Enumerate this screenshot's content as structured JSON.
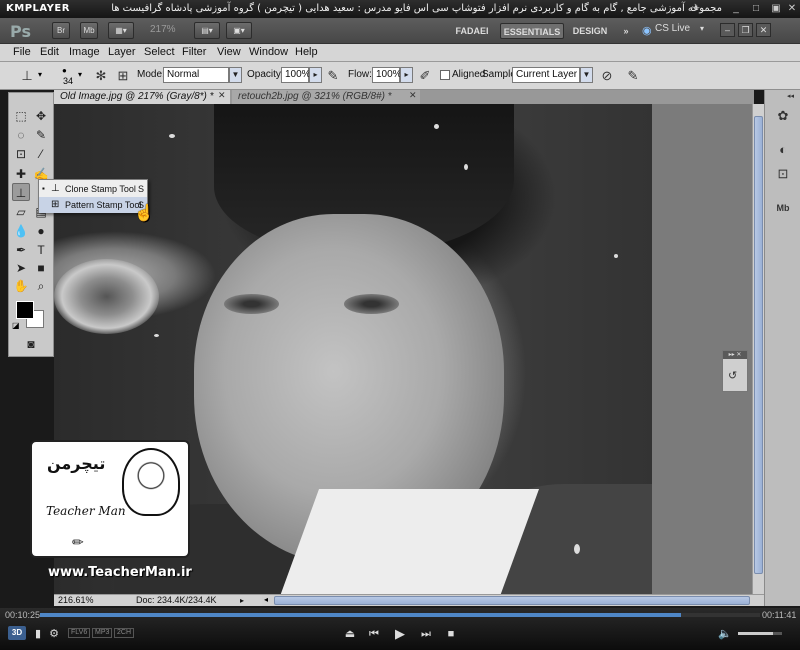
{
  "player": {
    "logo": "KMPLAYER",
    "caption": "مجموعه آموزشی جامع , گام به گام و کاربردی نرم افزار فتوشاپ سی اس فایو مدرس : سعید هدایی ( تیچرمن ) گروه آموزشی پادشاه گرافیست ها",
    "time_elapsed": "00:10:25",
    "time_total": "00:11:41",
    "progress": 0.89,
    "volume": 0.8,
    "codecs": [
      "FLV6",
      "MP3",
      "2CH"
    ],
    "badge_3d": "3D"
  },
  "appbar": {
    "logo": "Ps",
    "buttons": [
      "Br",
      "Mb"
    ],
    "zoom": "217%",
    "workspaces": [
      "FADAEI",
      "ESSENTIALS",
      "DESIGN"
    ],
    "more": "»",
    "cs_live": "CS Live"
  },
  "menu": [
    "File",
    "Edit",
    "Image",
    "Layer",
    "Select",
    "Filter",
    "View",
    "Window",
    "Help"
  ],
  "options": {
    "brush_size": "34",
    "mode_label": "Mode:",
    "mode_value": "Normal",
    "opacity_label": "Opacity:",
    "opacity_value": "100%",
    "flow_label": "Flow:",
    "flow_value": "100%",
    "aligned_label": "Aligned",
    "sample_label": "Sample:",
    "sample_value": "Current Layer"
  },
  "tabs": [
    {
      "label": "Old Image.jpg @ 217% (Gray/8*) *"
    },
    {
      "label": "retouch2b.jpg @ 321% (RGB/8#) *"
    }
  ],
  "flyout": [
    {
      "label": "Clone Stamp Tool",
      "shortcut": "S",
      "bullet": "▪"
    },
    {
      "label": "Pattern Stamp Tool",
      "shortcut": "S",
      "bullet": ""
    }
  ],
  "status": {
    "zoom": "216.61%",
    "doc": "Doc: 234.4K/234.4K"
  },
  "watermark": {
    "persian": "تیچرمن",
    "brand": "Teacher Man",
    "url": "www.TeacherMan.ir"
  }
}
